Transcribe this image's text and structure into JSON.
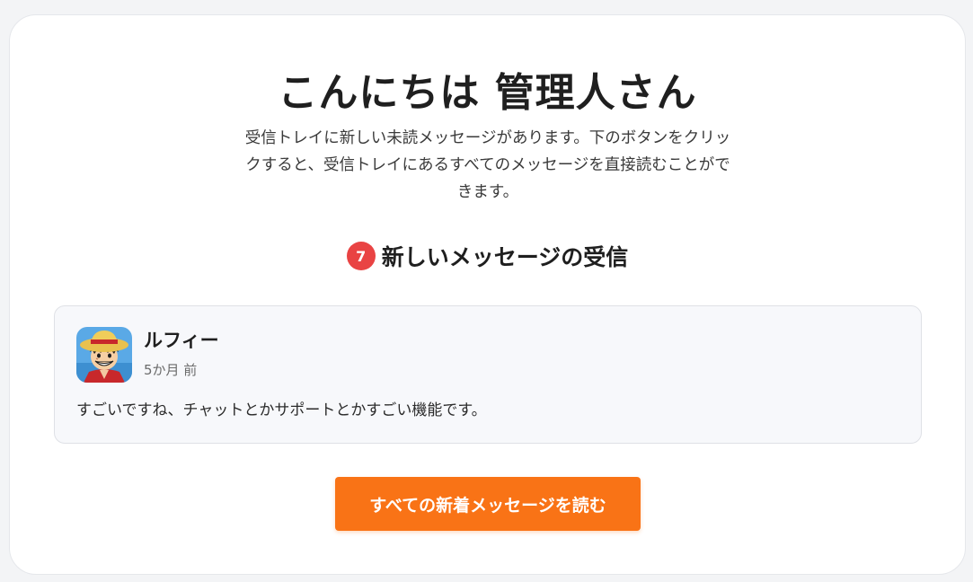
{
  "greeting": "こんにちは 管理人さん",
  "intro_lines": [
    "受信トレイに新しい未読メッセージがあります。下のボタンをクリッ",
    "クすると、受信トレイにあるすべてのメッセージを直接読むことがで",
    "きます。"
  ],
  "new_messages": {
    "count": "7",
    "heading": "新しいメッセージの受信"
  },
  "message": {
    "avatar_icon": "luffy-avatar-icon",
    "sender": "ルフィー",
    "time": "5か月 前",
    "body": "すごいですね、チャットとかサポートとかすごい機能です。"
  },
  "button": {
    "label": "すべての新着メッセージを読む"
  },
  "colors": {
    "accent": "#f97316",
    "badge": "#e94343",
    "message_bg": "#f7f8fb"
  }
}
